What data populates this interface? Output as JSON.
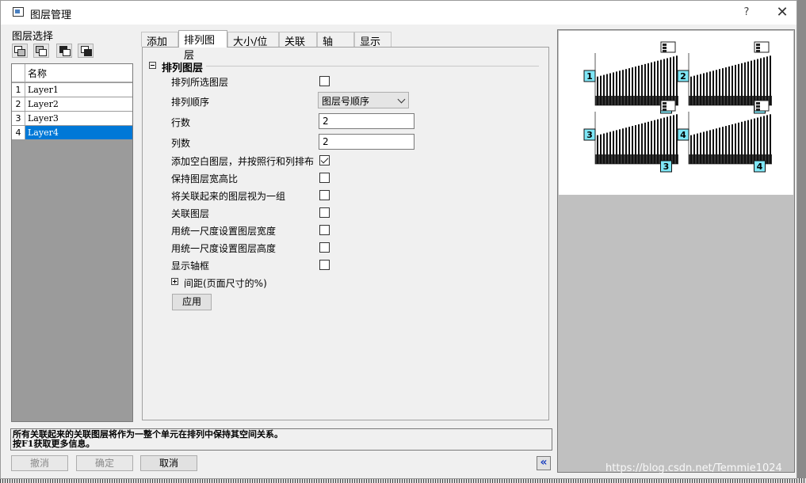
{
  "window": {
    "title": "图层管理",
    "help": "?",
    "close": "✕"
  },
  "layer_select": {
    "label": "图层选择",
    "column_header": "名称",
    "rows": [
      {
        "num": "1",
        "name": "Layer1",
        "selected": false
      },
      {
        "num": "2",
        "name": "Layer2",
        "selected": false
      },
      {
        "num": "3",
        "name": "Layer3",
        "selected": false
      },
      {
        "num": "4",
        "name": "Layer4",
        "selected": true
      }
    ]
  },
  "tabs": [
    {
      "label": "添加",
      "active": false
    },
    {
      "label": "排列图层",
      "active": true
    },
    {
      "label": "大小/位置",
      "active": false
    },
    {
      "label": "关联",
      "active": false
    },
    {
      "label": "轴",
      "active": false
    },
    {
      "label": "显示",
      "active": false
    }
  ],
  "arrange": {
    "group_title": "排列图层",
    "arrange_selected": {
      "label": "排列所选图层",
      "checked": false
    },
    "order": {
      "label": "排列顺序",
      "value": "图层号顺序"
    },
    "rows": {
      "label": "行数",
      "value": "2"
    },
    "cols": {
      "label": "列数",
      "value": "2"
    },
    "add_blank": {
      "label": "添加空白图层，并按照行和列排布",
      "checked": true
    },
    "keep_ratio": {
      "label": "保持图层宽高比",
      "checked": false
    },
    "linked_group": {
      "label": "将关联起来的图层视为一组",
      "checked": false
    },
    "link_layers": {
      "label": "关联图层",
      "checked": false
    },
    "uniform_width": {
      "label": "用统一尺度设置图层宽度",
      "checked": false
    },
    "uniform_height": {
      "label": "用统一尺度设置图层高度",
      "checked": false
    },
    "show_frame": {
      "label": "显示轴框",
      "checked": false
    },
    "spacing": {
      "label": "间距(页面尺寸的%)"
    },
    "apply": "应用"
  },
  "preview": {
    "panel_labels": [
      "1",
      "2",
      "3",
      "4"
    ],
    "accent": "#7fe7f7"
  },
  "status": {
    "line1": "所有关联起来的关联图层将作为一整个单元在排列中保持其空间关系。",
    "line2": "按F1获取更多信息。"
  },
  "buttons": {
    "undo": "撤消",
    "ok": "确定",
    "cancel": "取消",
    "collapse": "«"
  },
  "watermark": "https://blog.csdn.net/Temmie1024"
}
